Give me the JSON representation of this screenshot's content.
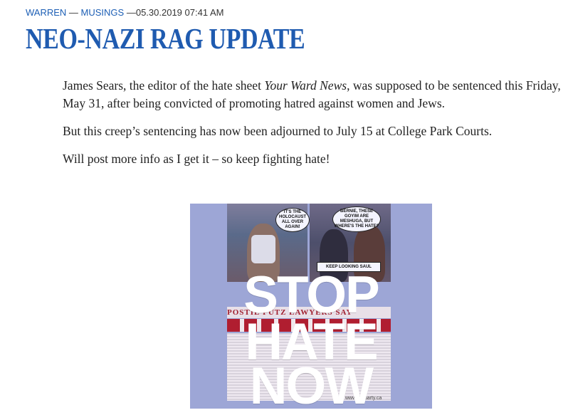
{
  "meta": {
    "author": "WARREN",
    "separator": "—",
    "category": "MUSINGS",
    "dash": "—",
    "timestamp": "05.30.2019 07:41 AM"
  },
  "title": "NEO-NAZI RAG UPDATE",
  "body": {
    "p1_before": "James Sears, the editor of the hate sheet ",
    "p1_em": "Your Ward News",
    "p1_after": ", was supposed to be sentenced this Friday, May 31, after being convicted of promoting hatred against women and Jews.",
    "p2": "But this creep’s sentencing has now been adjourned to July 15 at College Park Courts.",
    "p3": "Will post more info as I get it – so keep fighting hate!"
  },
  "poster": {
    "bubble_left": "IT'S THE HOLOCAUST ALL OVER AGAIN!",
    "bubble_right": "BERNIE, THESE GOYIM ARE MESHUGA, BUT WHERE'S THE HATE?",
    "caption": "KEEP LOOKING SAUL",
    "headline": "POSTIE PUTZ  LAWYERS SAY",
    "word1": "STOP",
    "word2": "HATE",
    "word3": "NOW",
    "url": "www.NCparty.ca",
    "bg_color": "#9da6d6"
  }
}
